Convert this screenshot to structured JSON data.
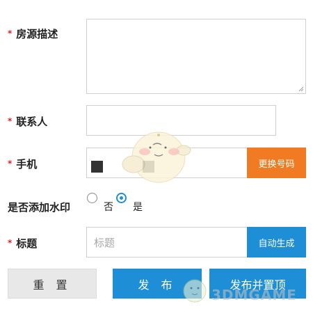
{
  "form": {
    "required_mark": "*",
    "description": {
      "label": "房源描述"
    },
    "contact": {
      "label": "联系人"
    },
    "phone": {
      "label": "手机",
      "change_button": "更换号码"
    },
    "watermark_option": {
      "label": "是否添加水印",
      "options": [
        "否",
        "是"
      ],
      "selected": "是"
    },
    "title": {
      "label": "标题",
      "placeholder": "标题",
      "auto_button": "自动生成"
    }
  },
  "actions": {
    "reset": "重 置",
    "publish": "发 布",
    "publish_top": "发布并置顶"
  },
  "overlay": {
    "watermark_text": "3DMGAME"
  },
  "colors": {
    "accent_blue": "#1e8fd6",
    "accent_orange": "#f07b22",
    "required_red": "#e02020"
  }
}
